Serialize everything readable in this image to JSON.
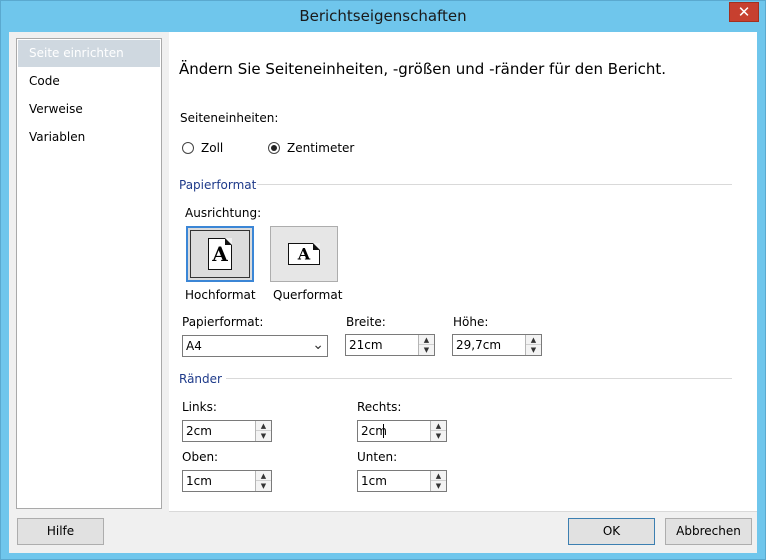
{
  "window": {
    "title": "Berichtseigenschaften",
    "close_glyph": "✕"
  },
  "nav": {
    "items": [
      {
        "label": "Seite einrichten",
        "selected": true
      },
      {
        "label": "Code"
      },
      {
        "label": "Verweise"
      },
      {
        "label": "Variablen"
      }
    ]
  },
  "page": {
    "heading": "Ändern Sie Seiteneinheiten, -größen und -ränder für den Bericht.",
    "units": {
      "label": "Seiteneinheiten:",
      "options": [
        {
          "label": "Zoll",
          "checked": false
        },
        {
          "label": "Zentimeter",
          "checked": true
        }
      ]
    },
    "paper": {
      "section_label": "Papierformat",
      "orientation_label": "Ausrichtung:",
      "portrait": {
        "label": "Hochformat",
        "glyph": "A"
      },
      "landscape": {
        "label": "Querformat",
        "glyph": "A"
      },
      "format_label": "Papierformat:",
      "format_value": "A4",
      "width_label": "Breite:",
      "width_value": "21cm",
      "height_label": "Höhe:",
      "height_value": "29,7cm"
    },
    "margins": {
      "section_label": "Ränder",
      "left_label": "Links:",
      "left_value": "2cm",
      "right_label": "Rechts:",
      "right_value": "2cm",
      "top_label": "Oben:",
      "top_value": "1cm",
      "bottom_label": "Unten:",
      "bottom_value": "1cm"
    }
  },
  "footer": {
    "help_label": "Hilfe",
    "ok_label": "OK",
    "cancel_label": "Abbrechen"
  },
  "colors": {
    "title_bar": "#6fc6ec",
    "close_button": "#c7402f",
    "section_label": "#1e3a8a",
    "selected_focus": "#3b86d6"
  }
}
